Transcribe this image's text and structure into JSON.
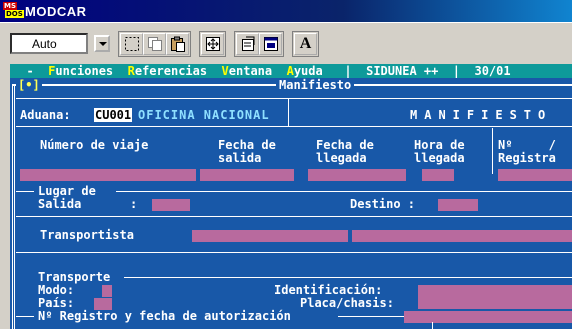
{
  "window": {
    "title": "MODCAR",
    "icon_top": "MS",
    "icon_bottom": "DOS"
  },
  "toolbar": {
    "font_size": "Auto",
    "font_button_label": "A"
  },
  "menu": {
    "items": [
      {
        "hotkey": "F",
        "rest": "unciones"
      },
      {
        "hotkey": "R",
        "rest": "eferencias"
      },
      {
        "hotkey": "V",
        "rest": "entana"
      },
      {
        "hotkey": "A",
        "rest": "yuda"
      }
    ],
    "system": "SIDUNEA ++",
    "date_fragment": "30/01"
  },
  "frame": {
    "marker": "[•]",
    "title": "Manifiesto"
  },
  "form": {
    "aduana_label": "Aduana:",
    "aduana_code": "CU001",
    "aduana_name": "OFICINA NACIONAL",
    "doc_heading": "MANIFIESTO",
    "col_numero": "Número de viaje",
    "col_fecha_salida_1": "Fecha de",
    "col_fecha_salida_2": "salida",
    "col_fecha_llegada_1": "Fecha de",
    "col_fecha_llegada_2": "llegada",
    "col_hora_1": "Hora de",
    "col_hora_2": "llegada",
    "col_num_registro_1": "Nº     /",
    "col_num_registro_2": "Registra",
    "lugar_de": "Lugar de",
    "salida_label": "Salida",
    "colon": ":",
    "destino_label": "Destino :",
    "transportista_label": "Transportista",
    "transporte_label": "Transporte",
    "modo_label": "Modo:",
    "pais_label": "País:",
    "identificacion_label": "Identificación:",
    "placa_label": "Placa/chasis:",
    "registro_label": "Nº Registro y fecha de autorización"
  },
  "colors": {
    "terminal_bg": "#1858a8",
    "menu_bg": "#0e9a9a",
    "field_bg": "#b86a9e",
    "hotkey": "#ffff00"
  }
}
